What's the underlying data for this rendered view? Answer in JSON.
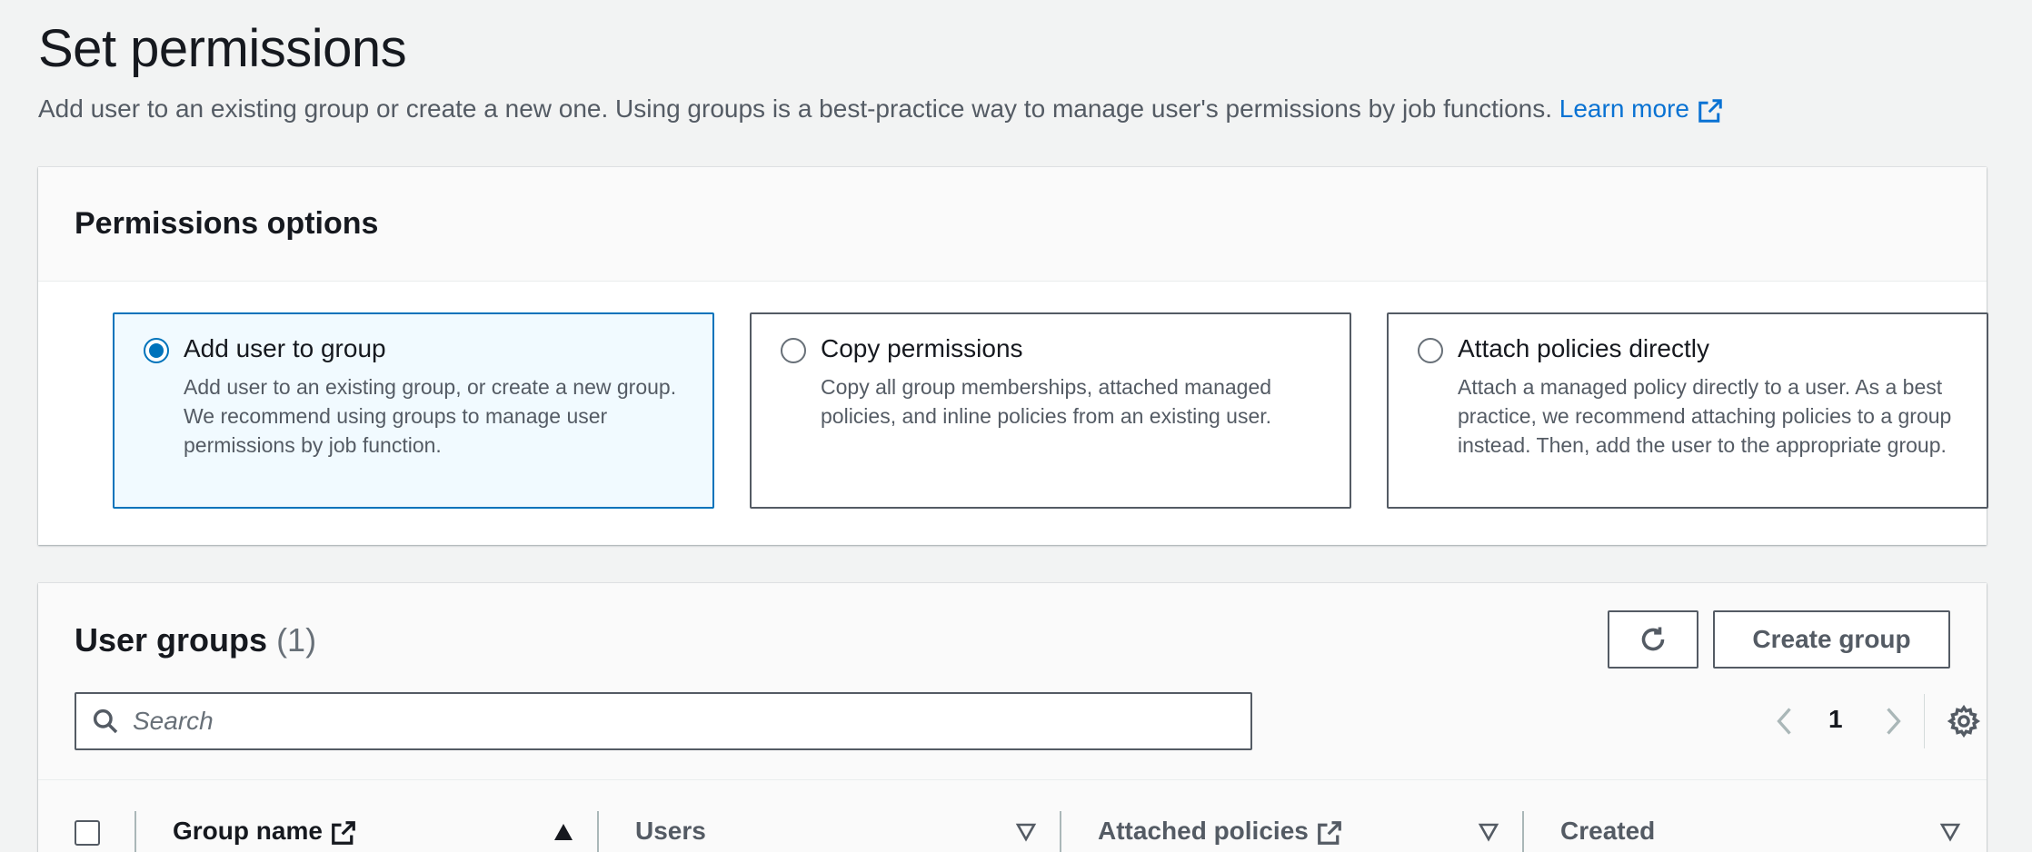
{
  "page": {
    "title": "Set permissions",
    "description": "Add user to an existing group or create a new one. Using groups is a best-practice way to manage user's permissions by job functions.",
    "learn_more": "Learn more"
  },
  "permissions_options": {
    "title": "Permissions options",
    "options": [
      {
        "label": "Add user to group",
        "description": "Add user to an existing group, or create a new group. We recommend using groups to manage user permissions by job function.",
        "selected": true
      },
      {
        "label": "Copy permissions",
        "description": "Copy all group memberships, attached managed policies, and inline policies from an existing user.",
        "selected": false
      },
      {
        "label": "Attach policies directly",
        "description": "Attach a managed policy directly to a user. As a best practice, we recommend attaching policies to a group instead. Then, add the user to the appropriate group.",
        "selected": false
      }
    ]
  },
  "user_groups": {
    "title": "User groups",
    "count": "(1)",
    "create_button": "Create group",
    "search_placeholder": "Search",
    "page_number": "1",
    "columns": [
      {
        "label": "Group name",
        "external_link": true,
        "sort": "ascending"
      },
      {
        "label": "Users",
        "external_link": false,
        "sort": "none"
      },
      {
        "label": "Attached policies",
        "external_link": true,
        "sort": "none"
      },
      {
        "label": "Created",
        "external_link": false,
        "sort": "none"
      }
    ]
  },
  "colors": {
    "link": "#0972d3",
    "selected_border": "#0073bb",
    "selected_bg": "#f1faff",
    "page_bg": "#f2f3f3"
  },
  "icons": [
    "external-link-icon",
    "refresh-icon",
    "search-icon",
    "chevron-left-icon",
    "chevron-right-icon",
    "settings-gear-icon",
    "sort-ascending-icon",
    "sort-descending-icon"
  ]
}
